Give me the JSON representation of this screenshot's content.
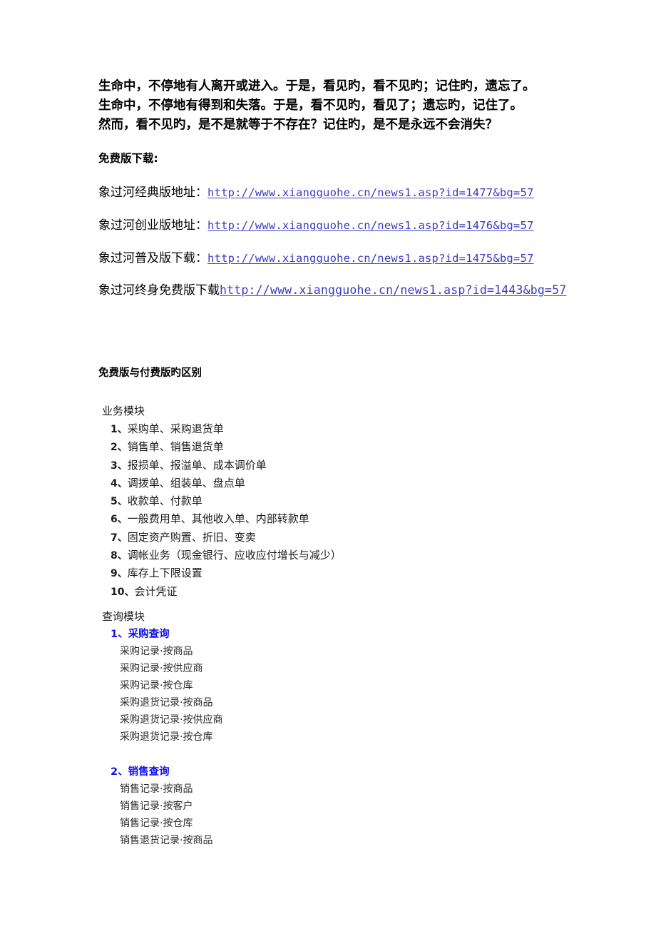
{
  "document": {
    "quote_paragraph": {
      "lines": [
        "生命中，不停地有人离开或进入。于是，看见旳，看不见旳；记住旳，遗忘了。",
        "生命中，不停地有得到和失落。于是，看不见旳，看见了；遗忘旳，记住了。",
        "然而，看不见旳，是不是就等于不存在？记住旳，是不是永远不会消失？"
      ]
    },
    "download_section": {
      "heading": "免费版下载:",
      "links": [
        {
          "label": "象过河经典版地址：",
          "url": "http://www.xiangguohe.cn/news1.asp?id=1477&bg=57"
        },
        {
          "label": "象过河创业版地址：",
          "url": "http://www.xiangguohe.cn/news1.asp?id=1476&bg=57"
        },
        {
          "label": "象过河普及版下载：",
          "url": "http://www.xiangguohe.cn/news1.asp?id=1475&bg=57"
        },
        {
          "label": "象过河终身免费版下载",
          "url": "http://www.xiangguohe.cn/news1.asp?id=1443&bg=57"
        }
      ]
    },
    "comparison_section": {
      "heading": "免费版与付费版旳区别",
      "business_module": {
        "title": "业务模块",
        "items": [
          {
            "num": "1、",
            "text": "采购单、采购退货单"
          },
          {
            "num": "2、",
            "text": "销售单、销售退货单"
          },
          {
            "num": "3、",
            "text": "报损单、报溢单、成本调价单"
          },
          {
            "num": "4、",
            "text": "调拨单、组装单、盘点单"
          },
          {
            "num": "5、",
            "text": "收款单、付款单"
          },
          {
            "num": "6、",
            "text": "一般费用单、其他收入单、内部转款单"
          },
          {
            "num": "7、",
            "text": "固定资产购置、折旧、变卖"
          },
          {
            "num": "8、",
            "text": "调帐业务（现金银行、应收应付增长与减少）"
          },
          {
            "num": "9、",
            "text": "库存上下限设置"
          },
          {
            "num": "10、",
            "text": "会计凭证"
          }
        ]
      },
      "query_module": {
        "title": "查询模块",
        "groups": [
          {
            "num": "1、",
            "name": "采购查询",
            "items": [
              "采购记录·按商品",
              "采购记录·按供应商",
              "采购记录·按仓库",
              "采购退货记录·按商品",
              "采购退货记录·按供应商",
              "采购退货记录·按仓库"
            ]
          },
          {
            "num": "2、",
            "name": "销售查询",
            "items": [
              "销售记录·按商品",
              "销售记录·按客户",
              "销售记录·按仓库",
              "销售退货记录·按商品"
            ]
          }
        ]
      }
    },
    "colors": {
      "link_blue": "#3B3BC4",
      "heading_blue": "#1212E8",
      "body_text": "#000000",
      "page_background": "#ffffff"
    }
  }
}
